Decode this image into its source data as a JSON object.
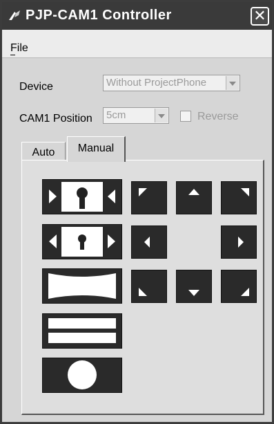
{
  "window": {
    "title": "PJP-CAM1 Controller",
    "close_icon": "close-icon",
    "app_icon": "camera-icon"
  },
  "menu": {
    "file": "File"
  },
  "device": {
    "label": "Device",
    "value": "Without ProjectPhone"
  },
  "cam_position": {
    "label": "CAM1 Position",
    "value": "5cm",
    "reverse_label": "Reverse",
    "reverse_checked": false
  },
  "tabs": [
    {
      "label": "Auto",
      "active": false
    },
    {
      "label": "Manual",
      "active": true
    }
  ],
  "manual_controls": {
    "left_buttons": [
      "zoom-in-icon",
      "zoom-out-icon",
      "keystone-icon",
      "split-screen-icon",
      "circle-icon"
    ],
    "arrows": [
      "up-left-arrow-icon",
      "up-arrow-icon",
      "up-right-arrow-icon",
      "left-arrow-icon",
      "right-arrow-icon",
      "down-left-arrow-icon",
      "down-arrow-icon",
      "down-right-arrow-icon"
    ]
  }
}
